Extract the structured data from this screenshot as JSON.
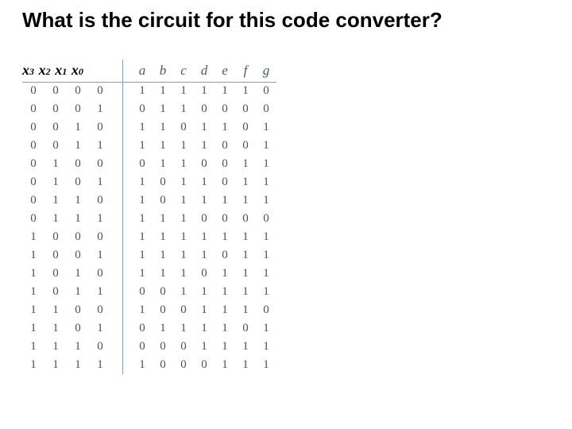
{
  "title": "What is the circuit for this code converter?",
  "input_vars": [
    {
      "name": "x",
      "sub": "3"
    },
    {
      "name": "x",
      "sub": "2"
    },
    {
      "name": "x",
      "sub": "1"
    },
    {
      "name": "x",
      "sub": "0"
    }
  ],
  "output_vars": [
    "a",
    "b",
    "c",
    "d",
    "e",
    "f",
    "g"
  ],
  "rows": [
    {
      "in": [
        "0",
        "0",
        "0",
        "0"
      ],
      "out": [
        "1",
        "1",
        "1",
        "1",
        "1",
        "1",
        "0"
      ]
    },
    {
      "in": [
        "0",
        "0",
        "0",
        "1"
      ],
      "out": [
        "0",
        "1",
        "1",
        "0",
        "0",
        "0",
        "0"
      ]
    },
    {
      "in": [
        "0",
        "0",
        "1",
        "0"
      ],
      "out": [
        "1",
        "1",
        "0",
        "1",
        "1",
        "0",
        "1"
      ]
    },
    {
      "in": [
        "0",
        "0",
        "1",
        "1"
      ],
      "out": [
        "1",
        "1",
        "1",
        "1",
        "0",
        "0",
        "1"
      ]
    },
    {
      "in": [
        "0",
        "1",
        "0",
        "0"
      ],
      "out": [
        "0",
        "1",
        "1",
        "0",
        "0",
        "1",
        "1"
      ]
    },
    {
      "in": [
        "0",
        "1",
        "0",
        "1"
      ],
      "out": [
        "1",
        "0",
        "1",
        "1",
        "0",
        "1",
        "1"
      ]
    },
    {
      "in": [
        "0",
        "1",
        "1",
        "0"
      ],
      "out": [
        "1",
        "0",
        "1",
        "1",
        "1",
        "1",
        "1"
      ]
    },
    {
      "in": [
        "0",
        "1",
        "1",
        "1"
      ],
      "out": [
        "1",
        "1",
        "1",
        "0",
        "0",
        "0",
        "0"
      ]
    },
    {
      "in": [
        "1",
        "0",
        "0",
        "0"
      ],
      "out": [
        "1",
        "1",
        "1",
        "1",
        "1",
        "1",
        "1"
      ]
    },
    {
      "in": [
        "1",
        "0",
        "0",
        "1"
      ],
      "out": [
        "1",
        "1",
        "1",
        "1",
        "0",
        "1",
        "1"
      ]
    },
    {
      "in": [
        "1",
        "0",
        "1",
        "0"
      ],
      "out": [
        "1",
        "1",
        "1",
        "0",
        "1",
        "1",
        "1"
      ]
    },
    {
      "in": [
        "1",
        "0",
        "1",
        "1"
      ],
      "out": [
        "0",
        "0",
        "1",
        "1",
        "1",
        "1",
        "1"
      ]
    },
    {
      "in": [
        "1",
        "1",
        "0",
        "0"
      ],
      "out": [
        "1",
        "0",
        "0",
        "1",
        "1",
        "1",
        "0"
      ]
    },
    {
      "in": [
        "1",
        "1",
        "0",
        "1"
      ],
      "out": [
        "0",
        "1",
        "1",
        "1",
        "1",
        "0",
        "1"
      ]
    },
    {
      "in": [
        "1",
        "1",
        "1",
        "0"
      ],
      "out": [
        "0",
        "0",
        "0",
        "1",
        "1",
        "1",
        "1"
      ]
    },
    {
      "in": [
        "1",
        "1",
        "1",
        "1"
      ],
      "out": [
        "1",
        "0",
        "0",
        "0",
        "1",
        "1",
        "1"
      ]
    }
  ]
}
